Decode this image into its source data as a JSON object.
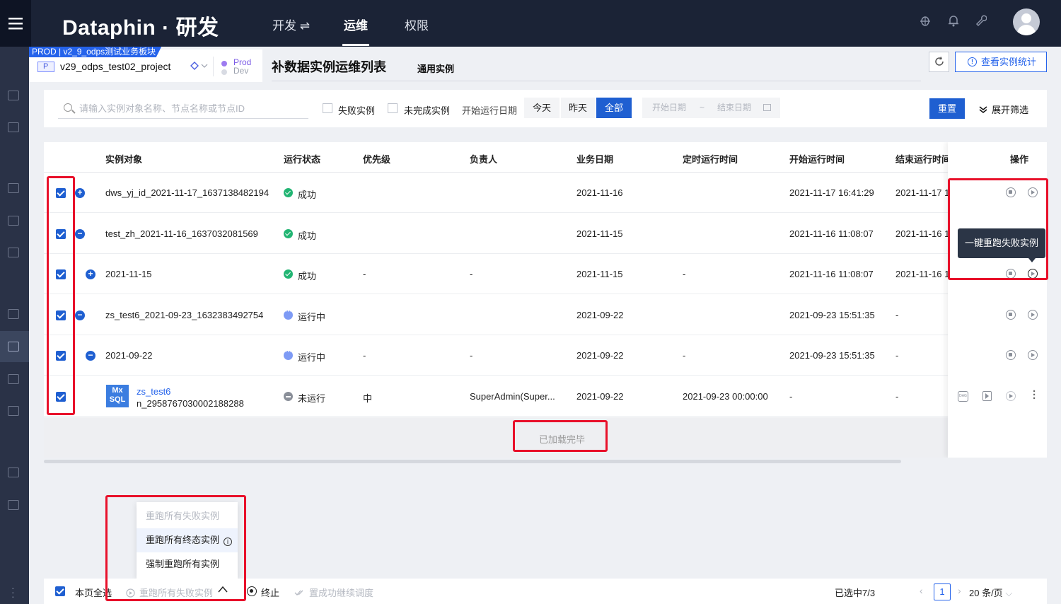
{
  "topbar": {
    "brand": "Dataphin · 研发",
    "nav": [
      {
        "label": "开发 ⇌"
      },
      {
        "label": "运维"
      },
      {
        "label": "权限"
      }
    ]
  },
  "project": {
    "tag": "PROD | v2_9_odps测试业务板块",
    "badge": "P",
    "name": "v29_odps_test02_project",
    "env_prod": "Prod",
    "env_dev": "Dev"
  },
  "page": {
    "title": "补数据实例运维列表",
    "sub_tab": "通用实例",
    "stats_button": "查看实例统计"
  },
  "filters": {
    "search_placeholder": "请输入实例对象名称、节点名称或节点ID",
    "failed_label": "失败实例",
    "unfinished_label": "未完成实例",
    "start_date_label": "开始运行日期",
    "seg_today": "今天",
    "seg_yesterday": "昨天",
    "seg_all": "全部",
    "date_start": "开始日期",
    "date_sep": "~",
    "date_end": "结束日期",
    "reset": "重置",
    "expand": "展开筛选"
  },
  "table": {
    "columns": [
      "实例对象",
      "运行状态",
      "优先级",
      "负责人",
      "业务日期",
      "定时运行时间",
      "开始运行时间",
      "结束运行时间",
      "操作"
    ],
    "rows": [
      {
        "expander": "+",
        "name": "dws_yj_id_2021-11-17_1637138482194",
        "status": "成功",
        "status_kind": "ok",
        "priority": "",
        "owner": "",
        "biz_date": "2021-11-16",
        "sched": "",
        "start": "2021-11-17 16:41:29",
        "end": "2021-11-17 1"
      },
      {
        "expander": "−",
        "name": "test_zh_2021-11-16_1637032081569",
        "status": "成功",
        "status_kind": "ok",
        "priority": "",
        "owner": "",
        "biz_date": "2021-11-15",
        "sched": "",
        "start": "2021-11-16 11:08:07",
        "end": "2021-11-16 1"
      },
      {
        "expander": "+",
        "name": "2021-11-15",
        "status": "成功",
        "status_kind": "ok",
        "priority": "-",
        "owner": "-",
        "biz_date": "2021-11-15",
        "sched": "-",
        "start": "2021-11-16 11:08:07",
        "end": "2021-11-16 1"
      },
      {
        "expander": "−",
        "name": "zs_test6_2021-09-23_1632383492754",
        "status": "运行中",
        "status_kind": "run",
        "priority": "",
        "owner": "",
        "biz_date": "2021-09-22",
        "sched": "",
        "start": "2021-09-23 15:51:35",
        "end": "-"
      },
      {
        "expander": "−",
        "name": "2021-09-22",
        "status": "运行中",
        "status_kind": "run",
        "priority": "-",
        "owner": "-",
        "biz_date": "2021-09-22",
        "sched": "-",
        "start": "2021-09-23 15:51:35",
        "end": "-"
      },
      {
        "badge_top": "Mx",
        "badge_bottom": "SQL",
        "name": "zs_test6",
        "node_id": "n_2958767030002188288",
        "status": "未运行",
        "status_kind": "idle",
        "priority": "中",
        "owner": "SuperAdmin(Super...",
        "biz_date": "2021-09-22",
        "sched": "2021-09-23 00:00:00",
        "start": "-",
        "end": "-"
      }
    ],
    "loaded_text": "已加载完毕",
    "tooltip": "一键重跑失败实例"
  },
  "dropdown": {
    "items": [
      {
        "label": "重跑所有失败实例"
      },
      {
        "label": "重跑所有终态实例",
        "info": "i"
      },
      {
        "label": "强制重跑所有实例"
      }
    ]
  },
  "footer": {
    "select_all": "本页全选",
    "rerun_failed": "重跑所有失败实例",
    "stop": "终止",
    "continue": "置成功继续调度",
    "selected": "已选中7/3",
    "page": "1",
    "per_page": "20 条/页"
  },
  "colors": {
    "primary": "#1f5fd1",
    "topbar": "#1b2336",
    "highlight": "#e8102a",
    "success": "#22b573"
  }
}
